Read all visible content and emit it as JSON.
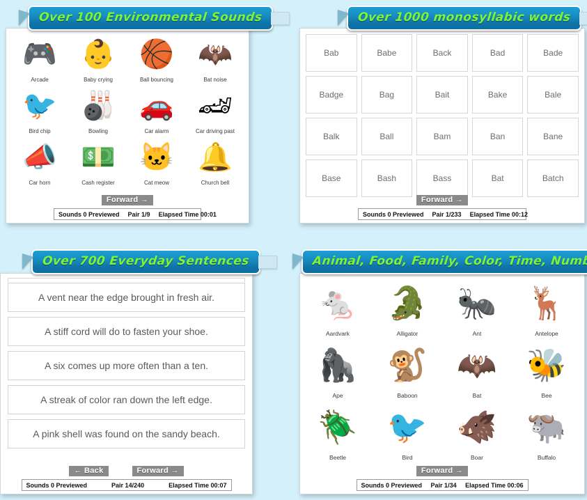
{
  "theme": {
    "page_background": "#d4f0fa",
    "banner_gradient_top": "#1b9fd4",
    "banner_gradient_bottom": "#0d6ea2",
    "banner_text_color": "#7cf43a",
    "button_color": "#8a8a8a"
  },
  "panels": [
    {
      "id": "environmental-sounds",
      "title": "Over 100 Environmental Sounds",
      "type": "icon-grid",
      "items": [
        {
          "label": "Arcade",
          "icon": "pinball-machine-icon",
          "glyph": "🎮"
        },
        {
          "label": "Baby crying",
          "icon": "crying-baby-icon",
          "glyph": "👶"
        },
        {
          "label": "Ball bouncing",
          "icon": "basketball-icon",
          "glyph": "🏀"
        },
        {
          "label": "Bat noise",
          "icon": "bat-sound-icon",
          "glyph": "🦇"
        },
        {
          "label": "Bird chip",
          "icon": "birdcage-icon",
          "glyph": "🐦"
        },
        {
          "label": "Bowling",
          "icon": "bowling-icon",
          "glyph": "🎳"
        },
        {
          "label": "Car alarm",
          "icon": "car-alarm-icon",
          "glyph": "🚗"
        },
        {
          "label": "Car driving past",
          "icon": "race-car-icon",
          "glyph": "🏎"
        },
        {
          "label": "Car horn",
          "icon": "steering-wheel-icon",
          "glyph": "📣"
        },
        {
          "label": "Cash register",
          "icon": "cash-register-icon",
          "glyph": "💵"
        },
        {
          "label": "Cat meow",
          "icon": "cat-icon",
          "glyph": "🐱"
        },
        {
          "label": "Church bell",
          "icon": "church-bell-icon",
          "glyph": "🔔"
        }
      ],
      "buttons": [
        {
          "label": "Forward →",
          "name": "forward-button"
        }
      ],
      "status": {
        "previewed": "Sounds 0 Previewed",
        "pair": "Pair 1/9",
        "elapsed": "Elapsed Time 00:01"
      }
    },
    {
      "id": "monosyllabic-words",
      "title": "Over 1000 monosyllabic words",
      "type": "word-grid",
      "items": [
        {
          "label": "Bab"
        },
        {
          "label": "Babe"
        },
        {
          "label": "Back"
        },
        {
          "label": "Bad"
        },
        {
          "label": "Bade"
        },
        {
          "label": "Badge"
        },
        {
          "label": "Bag"
        },
        {
          "label": "Bait"
        },
        {
          "label": "Bake"
        },
        {
          "label": "Bale"
        },
        {
          "label": "Balk"
        },
        {
          "label": "Ball"
        },
        {
          "label": "Bam"
        },
        {
          "label": "Ban"
        },
        {
          "label": "Bane"
        },
        {
          "label": "Base"
        },
        {
          "label": "Bash"
        },
        {
          "label": "Bass"
        },
        {
          "label": "Bat"
        },
        {
          "label": "Batch"
        }
      ],
      "buttons": [
        {
          "label": "Forward →",
          "name": "forward-button"
        }
      ],
      "status": {
        "previewed": "Sounds 0 Previewed",
        "pair": "Pair 1/233",
        "elapsed": "Elapsed Time 00:12"
      }
    },
    {
      "id": "everyday-sentences",
      "title": "Over 700 Everyday Sentences",
      "type": "sentence-list",
      "items": [
        {
          "label": "A vent near the edge brought in fresh air."
        },
        {
          "label": "A stiff cord will do to fasten your shoe."
        },
        {
          "label": "A six comes up more often than a ten."
        },
        {
          "label": "A streak of color ran down the left edge."
        },
        {
          "label": "A pink shell was found on the sandy beach."
        }
      ],
      "buttons": [
        {
          "label": "← Back",
          "name": "back-button"
        },
        {
          "label": "Forward →",
          "name": "forward-button"
        }
      ],
      "status": {
        "previewed": "Sounds 0 Previewed",
        "pair": "Pair 14/240",
        "elapsed": "Elapsed Time 00:07"
      }
    },
    {
      "id": "animal-food-family-color-time-number",
      "title": "Animal, Food, Family, Color, Time, Number",
      "type": "icon-grid",
      "items": [
        {
          "label": "Aardvark",
          "icon": "aardvark-icon",
          "glyph": "🐁"
        },
        {
          "label": "Alligator",
          "icon": "alligator-icon",
          "glyph": "🐊"
        },
        {
          "label": "Ant",
          "icon": "ant-icon",
          "glyph": "🐜"
        },
        {
          "label": "Antelope",
          "icon": "antelope-icon",
          "glyph": "🦌"
        },
        {
          "label": "Ape",
          "icon": "ape-icon",
          "glyph": "🦍"
        },
        {
          "label": "Baboon",
          "icon": "baboon-icon",
          "glyph": "🐒"
        },
        {
          "label": "Bat",
          "icon": "bat-icon",
          "glyph": "🦇"
        },
        {
          "label": "Bee",
          "icon": "bee-icon",
          "glyph": "🐝"
        },
        {
          "label": "Beetle",
          "icon": "beetle-icon",
          "glyph": "🪲"
        },
        {
          "label": "Bird",
          "icon": "birdcage-icon",
          "glyph": "🐦"
        },
        {
          "label": "Boar",
          "icon": "boar-icon",
          "glyph": "🐗"
        },
        {
          "label": "Buffalo",
          "icon": "buffalo-icon",
          "glyph": "🐃"
        }
      ],
      "buttons": [
        {
          "label": "Forward →",
          "name": "forward-button"
        }
      ],
      "status": {
        "previewed": "Sounds 0 Previewed",
        "pair": "Pair 1/34",
        "elapsed": "Elapsed Time 00:06"
      }
    }
  ]
}
